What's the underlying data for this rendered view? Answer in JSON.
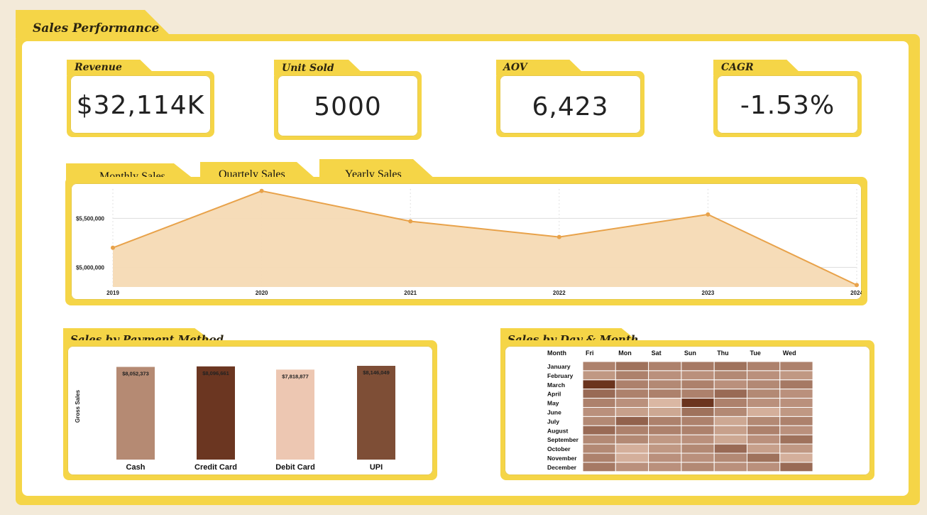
{
  "title": "Sales Performance",
  "kpis": [
    {
      "label": "Revenue",
      "value": "$32,114K"
    },
    {
      "label": "Unit Sold",
      "value": "5000"
    },
    {
      "label": "AOV",
      "value": "6,423"
    },
    {
      "label": "CAGR",
      "value": "-1.53%"
    }
  ],
  "trend_tabs": [
    "Monthly Sales",
    "Quartely Sales",
    "Yearly Sales"
  ],
  "payment_title": "Sales by Payment Method",
  "heatmap_title": "Sales by Day & Month",
  "colors": {
    "frame": "#f5d547",
    "background": "#f3ead9",
    "line": "#e8a24a",
    "area": "#f5dab4"
  },
  "chart_data": [
    {
      "type": "area",
      "x": [
        "2019",
        "2020",
        "2021",
        "2022",
        "2023",
        "2024"
      ],
      "values": [
        5200000,
        5780000,
        5470000,
        5310000,
        5540000,
        4820000
      ],
      "y_ticks": [
        "$5,000,000",
        "$5,500,000"
      ],
      "ylim": [
        4800000,
        5800000
      ],
      "grid": true
    },
    {
      "type": "bar",
      "categories": [
        "Cash",
        "Credit Card",
        "Debit Card",
        "UPI"
      ],
      "values": [
        8052373,
        8096661,
        7818877,
        8146049
      ],
      "value_labels": [
        "$8,052,373",
        "$8,096,661",
        "$7,818,877",
        "$8,146,049"
      ],
      "ylabel": "Gross Sales",
      "colors": [
        "#b58a73",
        "#6b3621",
        "#edc7b2",
        "#7e4e36"
      ]
    },
    {
      "type": "heatmap",
      "corner_label": "Month",
      "columns": [
        "Fri",
        "Mon",
        "Sat",
        "Sun",
        "Thu",
        "Tue",
        "Wed"
      ],
      "rows": [
        "January",
        "February",
        "March",
        "April",
        "May",
        "June",
        "July",
        "August",
        "September",
        "October",
        "November",
        "December"
      ],
      "intensity": [
        [
          0.5,
          0.6,
          0.5,
          0.55,
          0.6,
          0.5,
          0.5
        ],
        [
          0.35,
          0.5,
          0.4,
          0.4,
          0.45,
          0.4,
          0.35
        ],
        [
          1.0,
          0.5,
          0.45,
          0.5,
          0.4,
          0.45,
          0.55
        ],
        [
          0.65,
          0.5,
          0.5,
          0.5,
          0.65,
          0.45,
          0.4
        ],
        [
          0.5,
          0.4,
          0.15,
          1.0,
          0.5,
          0.4,
          0.4
        ],
        [
          0.4,
          0.3,
          0.25,
          0.6,
          0.45,
          0.2,
          0.35
        ],
        [
          0.45,
          0.7,
          0.5,
          0.5,
          0.25,
          0.45,
          0.5
        ],
        [
          0.65,
          0.5,
          0.5,
          0.5,
          0.3,
          0.5,
          0.4
        ],
        [
          0.45,
          0.45,
          0.35,
          0.4,
          0.25,
          0.4,
          0.6
        ],
        [
          0.45,
          0.2,
          0.35,
          0.45,
          0.65,
          0.3,
          0.35
        ],
        [
          0.5,
          0.2,
          0.4,
          0.4,
          0.45,
          0.6,
          0.2
        ],
        [
          0.55,
          0.4,
          0.4,
          0.45,
          0.4,
          0.4,
          0.65
        ]
      ]
    }
  ]
}
